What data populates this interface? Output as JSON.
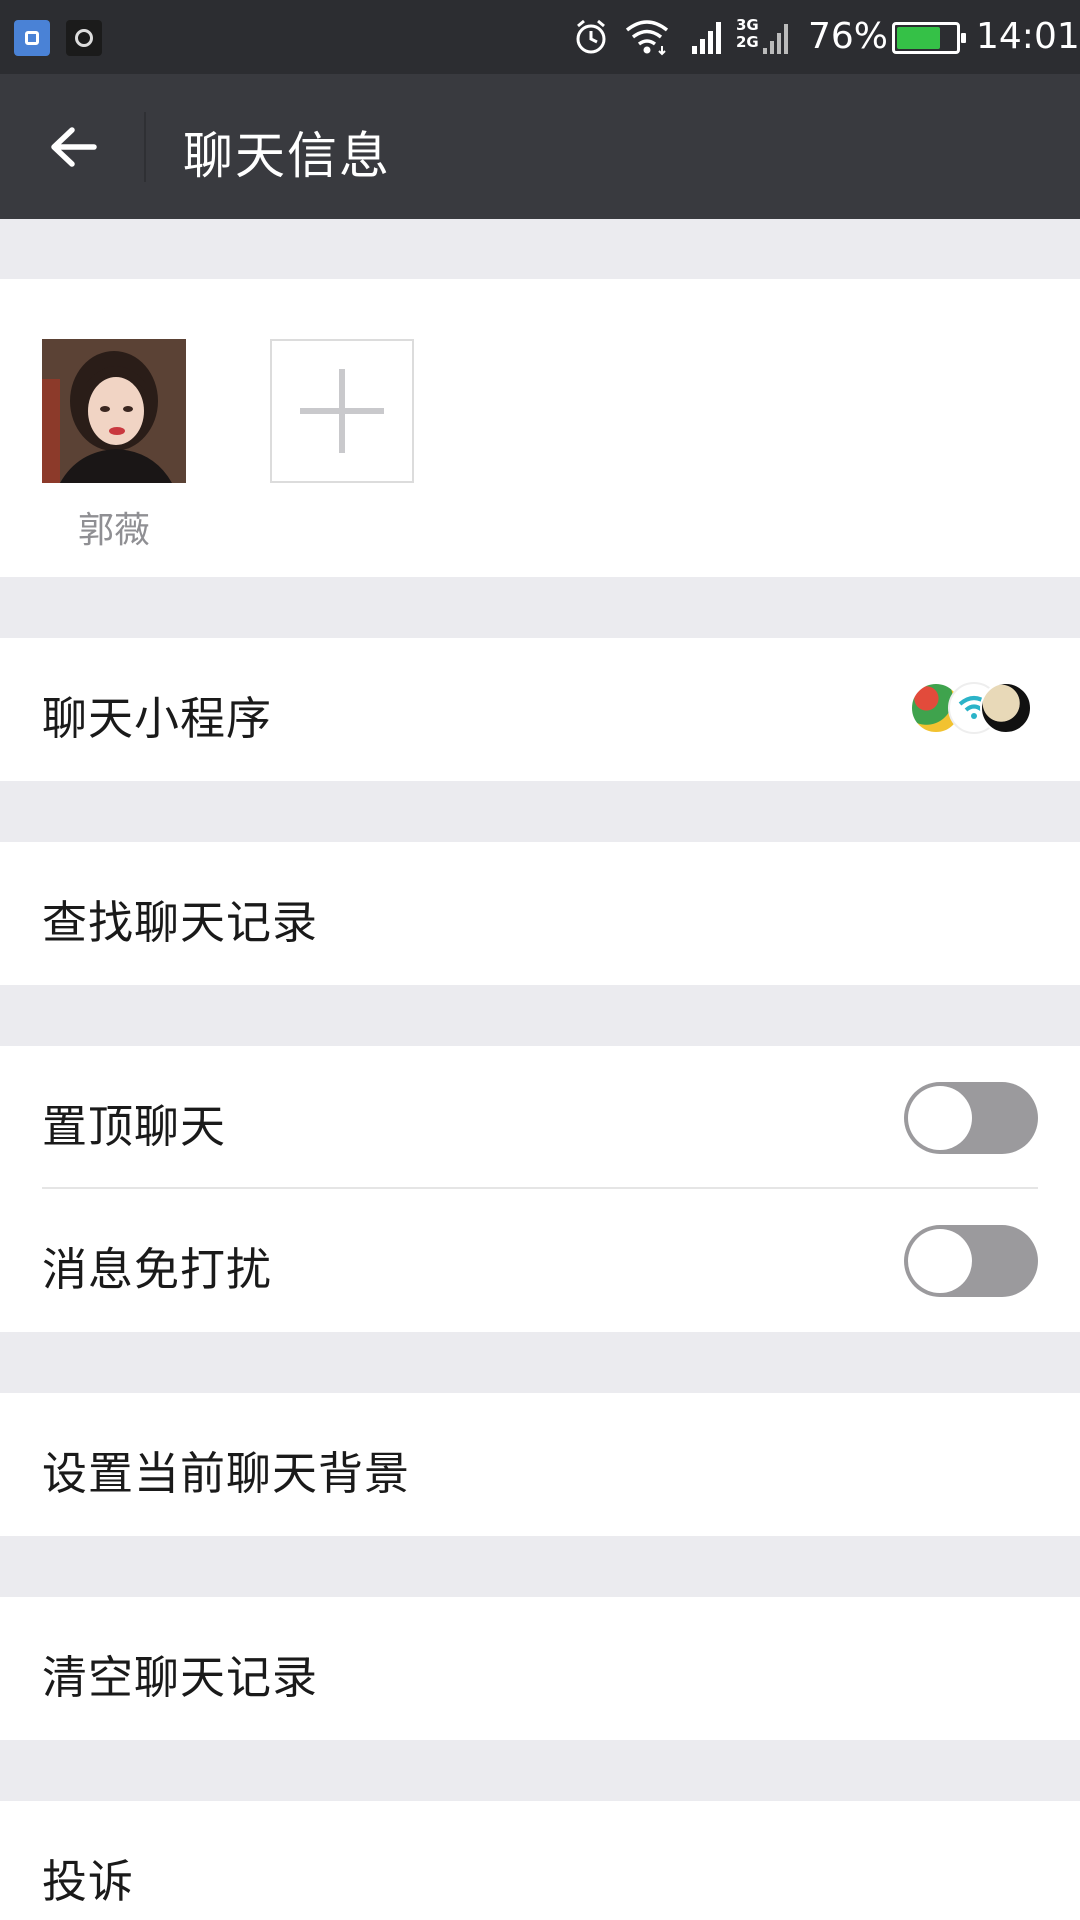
{
  "status_bar": {
    "battery_percent": "76%",
    "battery_level": 0.76,
    "time": "14:01",
    "network_labels": [
      "3G",
      "2G"
    ],
    "icons": [
      "app-notification-icon",
      "camera-notification-icon",
      "alarm-icon",
      "wifi-icon",
      "signal-icon",
      "battery-icon"
    ]
  },
  "title_bar": {
    "title": "聊天信息",
    "back_icon": "arrow-left-icon"
  },
  "members": {
    "list": [
      {
        "name": "郭薇"
      }
    ],
    "add_icon": "plus-icon"
  },
  "rows": {
    "mini_programs": {
      "label": "聊天小程序"
    },
    "search_history": {
      "label": "查找聊天记录"
    },
    "pin_chat": {
      "label": "置顶聊天",
      "enabled": false
    },
    "mute": {
      "label": "消息免打扰",
      "enabled": false
    },
    "set_background": {
      "label": "设置当前聊天背景"
    },
    "clear_history": {
      "label": "清空聊天记录"
    },
    "report": {
      "label": "投诉"
    }
  },
  "colors": {
    "status_bar_bg": "#2c2d31",
    "title_bar_bg": "#393a3f",
    "page_bg": "#ebebef",
    "toggle_off": "#9b9a9d",
    "battery_green": "#35c147"
  }
}
